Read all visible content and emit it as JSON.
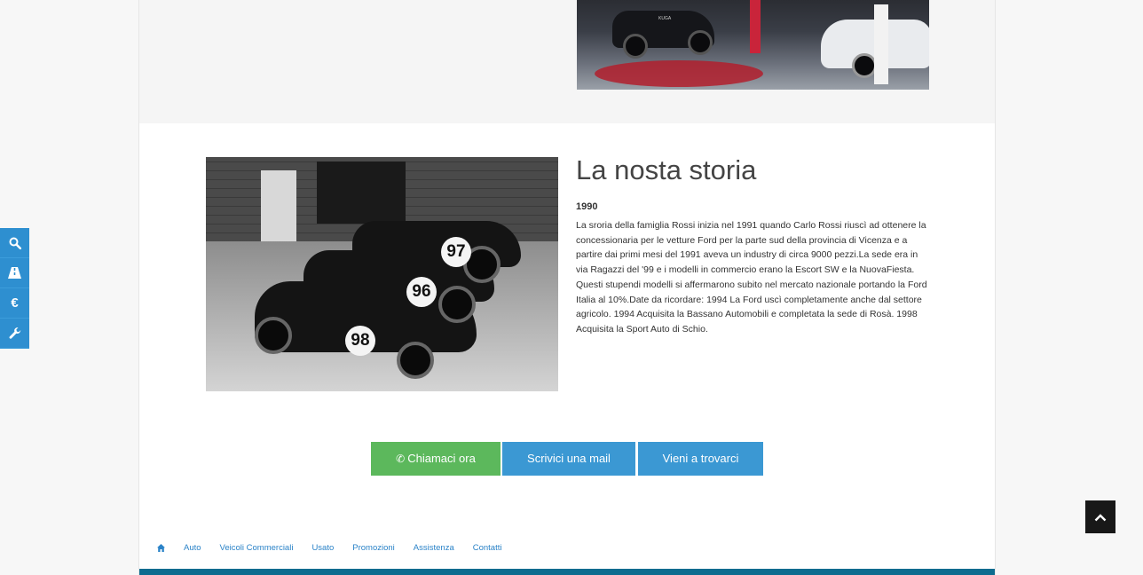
{
  "story": {
    "title": "La nosta storia",
    "year": "1990",
    "text": "La sroria della famiglia Rossi inizia nel 1991 quando Carlo Rossi riuscì ad ottenere la concessionaria per le vetture Ford per la parte sud della provincia di Vicenza e a partire dai primi mesi del 1991 aveva un industry di circa 9000 pezzi.La sede era in via Ragazzi del '99 e i modelli in commercio erano la Escort SW e la NuovaFiesta. Questi stupendi modelli si affermarono subito nel mercato nazionale portando la Ford Italia al 10%.Date da ricordare: 1994 La Ford uscì completamente anche dal settore agricolo. 1994 Acquisita la Bassano Automobili e completata la sede di Rosà. 1998 Acquisita la Sport Auto di Schio."
  },
  "history_image": {
    "car_numbers": [
      "97",
      "96",
      "98"
    ]
  },
  "showroom_image": {
    "badge": "KUGA"
  },
  "actions": {
    "call_label": "Chiamaci ora",
    "mail_label": "Scrivici una mail",
    "visit_label": "Vieni a trovarci"
  },
  "footer_nav": {
    "items": [
      "Auto",
      "Veicoli Commerciali",
      "Usato",
      "Promozioni",
      "Assistenza",
      "Contatti"
    ]
  },
  "side_tools": {
    "euro_symbol": "€"
  },
  "colors": {
    "call_button": "#5cb85c",
    "primary_button": "#3b98d3",
    "footer_bar": "#0d6c8f",
    "side_toolbar": "#2e8fd0"
  },
  "icons": [
    "search-icon",
    "road-icon",
    "euro-icon",
    "wrench-icon",
    "phone-icon",
    "home-icon",
    "chevron-up-icon"
  ]
}
